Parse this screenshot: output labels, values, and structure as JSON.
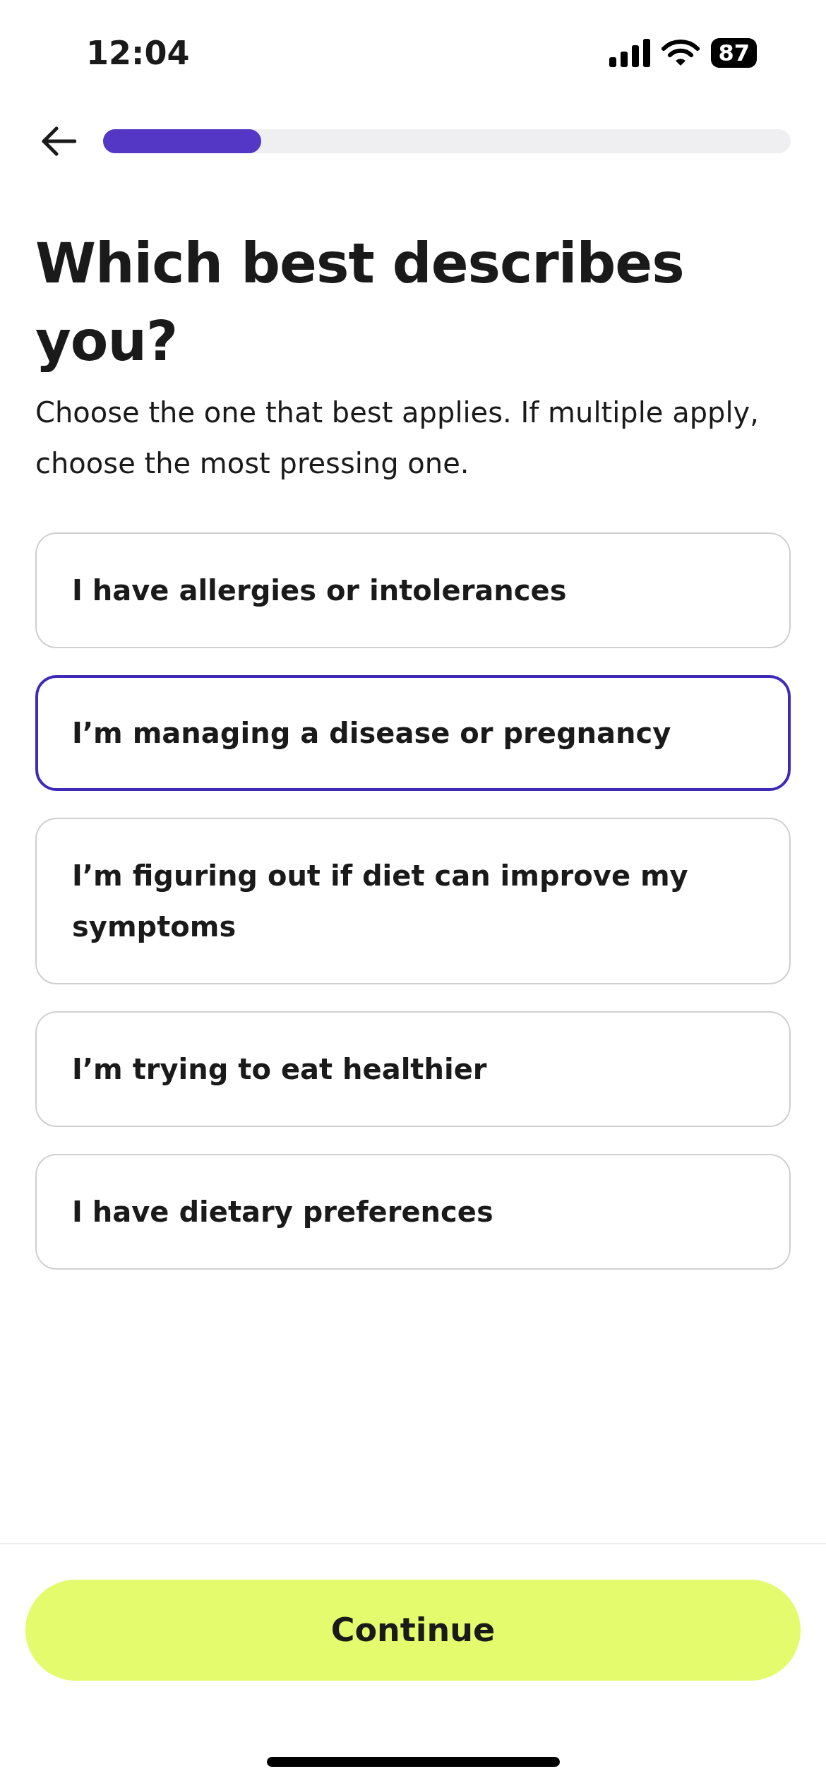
{
  "status_bar": {
    "time": "12:04",
    "battery": "87"
  },
  "progress": {
    "level": 0.23
  },
  "title": "Which best describes you?",
  "subtitle": "Choose the one that best applies. If multiple apply, choose the most pressing one.",
  "options": [
    {
      "label": "I have allergies or intolerances",
      "selected": false
    },
    {
      "label": "I’m managing a disease or pregnancy",
      "selected": true
    },
    {
      "label": "I’m figuring out if diet can improve my symptoms",
      "selected": false
    },
    {
      "label": "I’m trying to eat healthier",
      "selected": false
    },
    {
      "label": "I have dietary preferences",
      "selected": false
    }
  ],
  "continue_button": "Continue"
}
